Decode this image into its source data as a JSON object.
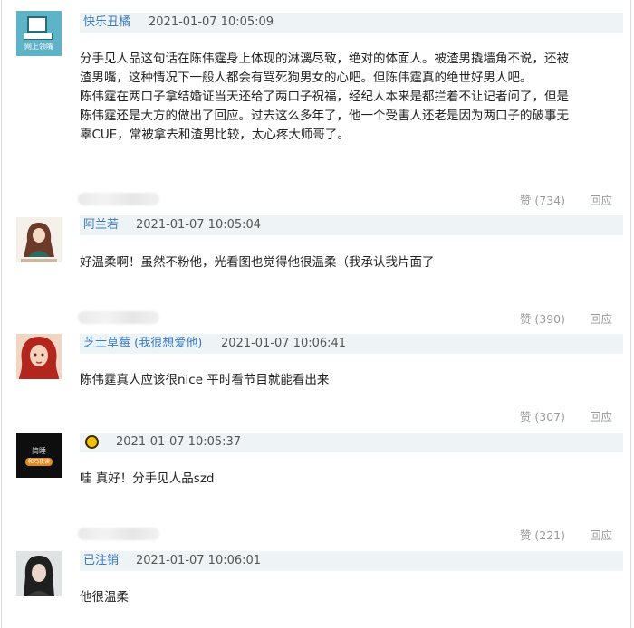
{
  "comments": [
    {
      "user": "快乐丑橘",
      "avatar_caption": "网上领嘴",
      "time": "2021-01-07 10:05:09",
      "lines": [
        "分手见人品这句话在陈伟霆身上体现的淋漓尽致，绝对的体面人。被渣男撬墙角不说，还被",
        "渣男嘴，这种情况下一般人都会有骂死狗男女的心吧。但陈伟霆真的绝世好男人吧。",
        "陈伟霆在两口子拿结婚证当天还给了两口子祝福，经纪人本来是都拦着不让记者问了，但是",
        "陈伟霆还是大方的做出了回应。过去这么多年了，他一个受害人还老是因为两口子的破事无",
        "辜CUE，常被拿去和渣男比较，太心疼大师哥了。"
      ],
      "likes": "赞 (734)",
      "reply": "回应"
    },
    {
      "user": "阿兰若",
      "time": "2021-01-07 10:05:04",
      "lines": [
        "好温柔啊！虽然不粉他，光看图也觉得他很温柔（我承认我片面了"
      ],
      "likes": "赞 (390)",
      "reply": "回应"
    },
    {
      "user": "芝士草莓 (我很想爱他)",
      "time": "2021-01-07 10:06:41",
      "lines": [
        "陈伟霆真人应该很nice 平时看节目就能看出来"
      ],
      "likes": "赞 (307)",
      "reply": "回应"
    },
    {
      "user": "",
      "avatar_caption_top": "简睡",
      "avatar_caption_bottom": "和鸣夜读",
      "time": "2021-01-07 10:05:37",
      "lines": [
        "哇 真好！分手见人品szd"
      ],
      "likes": "赞 (221)",
      "reply": "回应"
    },
    {
      "user": "已注销",
      "time": "2021-01-07 10:06:01",
      "lines": [
        "他很温柔"
      ]
    }
  ],
  "colors": {
    "username": "#3a7ac2",
    "header_bg": "#eef3f5",
    "muted": "#9a9a9a"
  }
}
